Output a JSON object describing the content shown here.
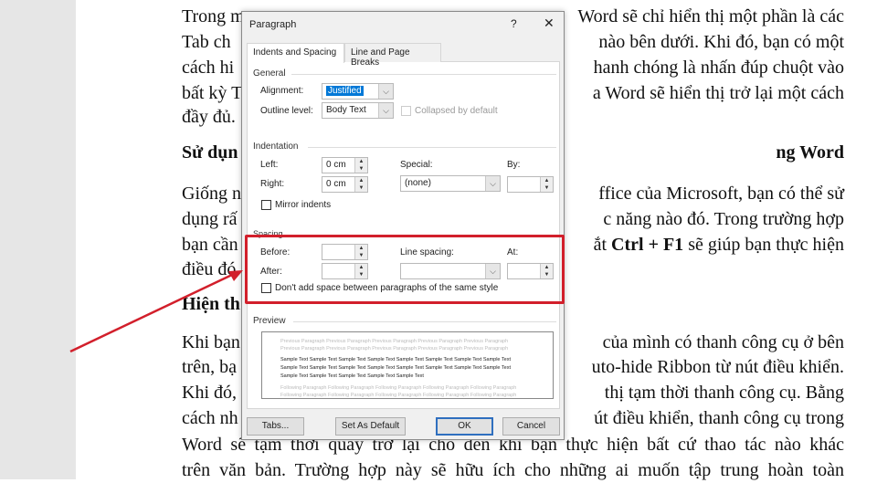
{
  "document": {
    "lines": [
      {
        "l": "Trong m",
        "r": "Word sẽ chỉ hiển thị một phần là các"
      },
      {
        "l": "Tab ch",
        "r": "nào bên dưới. Khi đó, bạn có một"
      },
      {
        "l": "cách hi",
        "r": "hanh chóng là nhấn đúp chuột vào"
      },
      {
        "l": "bất kỳ T",
        "r": "a Word sẽ hiển thị trở lại một cách"
      },
      {
        "l": "đầy đủ.",
        "r": ""
      },
      {
        "l": "Sử dụn",
        "r": "ng Word"
      },
      {
        "l": "Giống n",
        "r": "ffice của Microsoft, bạn có thể sử"
      },
      {
        "l": "dụng rấ",
        "r": "c năng nào đó. Trong trường hợp"
      },
      {
        "l": "bạn cần",
        "r_pre": "ắt ",
        "r_bold": "Ctrl + F1",
        "r_post": " sẽ giúp bạn thực hiện"
      },
      {
        "l": "điều đó",
        "r": ""
      },
      {
        "l": "Hiện th",
        "r": ""
      },
      {
        "l": "Khi bạn",
        "r": "của mình có thanh công cụ ở bên"
      },
      {
        "l": "trên, bạ",
        "r": "uto-hide Ribbon từ nút điều khiển."
      },
      {
        "l": "Khi đó,",
        "r": "thị tạm thời thanh công cụ. Bằng"
      },
      {
        "l": "cách nh",
        "r": "út điều khiển, thanh công cụ trong"
      },
      {
        "full": "Word sẽ tạm thời quay trở lại cho đến khi bạn thực hiện bất cứ thao tác nào khác"
      },
      {
        "full": "trên văn bản. Trường hợp này sẽ hữu ích cho những ai muốn tập trung hoàn toàn"
      }
    ]
  },
  "dialog": {
    "title": "Paragraph",
    "help": "?",
    "close": "✕",
    "tabs": [
      "Indents and Spacing",
      "Line and Page Breaks"
    ],
    "general": {
      "label": "General",
      "alignment_label": "Alignment:",
      "alignment_value": "Justified",
      "outline_label": "Outline level:",
      "outline_value": "Body Text",
      "collapsed_label": "Collapsed by default"
    },
    "indentation": {
      "label": "Indentation",
      "left_label": "Left:",
      "left_value": "0 cm",
      "right_label": "Right:",
      "right_value": "0 cm",
      "special_label": "Special:",
      "special_value": "(none)",
      "by_label": "By:",
      "by_value": "",
      "mirror_label": "Mirror indents"
    },
    "spacing": {
      "label": "Spacing",
      "before_label": "Before:",
      "before_value": "",
      "after_label": "After:",
      "after_value": "",
      "line_spacing_label": "Line spacing:",
      "line_spacing_value": "",
      "at_label": "At:",
      "at_value": "",
      "dont_add_label": "Don't add space between paragraphs of the same style"
    },
    "preview": {
      "label": "Preview",
      "prev1": "Previous Paragraph Previous Paragraph Previous Paragraph Previous Paragraph Previous Paragraph",
      "prev2": "Previous Paragraph Previous Paragraph Previous Paragraph Previous Paragraph Previous Paragraph",
      "sample1": "Sample Text Sample Text Sample Text Sample Text Sample Text Sample Text Sample Text Sample Text",
      "sample2": "Sample Text Sample Text Sample Text Sample Text Sample Text Sample Text Sample Text Sample Text",
      "sample3": "Sample Text Sample Text Sample Text Sample Text Sample Text",
      "follow1": "Following Paragraph Following Paragraph Following Paragraph Following Paragraph Following Paragraph",
      "follow2": "Following Paragraph Following Paragraph Following Paragraph Following Paragraph Following Paragraph"
    },
    "buttons": {
      "tabs": "Tabs...",
      "set_default": "Set As Default",
      "ok": "OK",
      "cancel": "Cancel"
    }
  },
  "colors": {
    "highlight": "#d21f2b",
    "selection": "#0078d7",
    "ok_border": "#2f6fbf"
  }
}
